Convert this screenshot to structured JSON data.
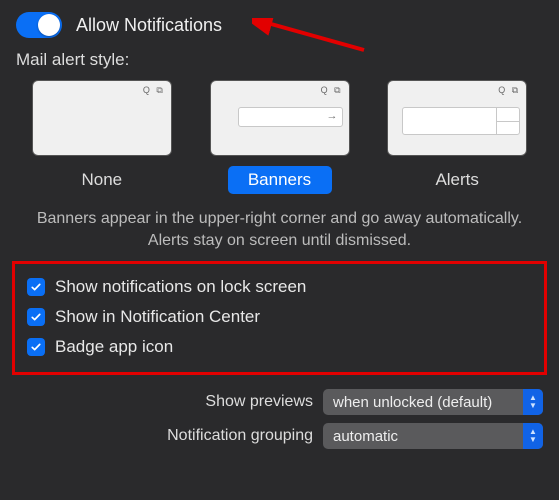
{
  "toggle": {
    "label": "Allow Notifications",
    "on": true
  },
  "sectionLabel": "Mail alert style:",
  "styles": {
    "none": "None",
    "banners": "Banners",
    "alerts": "Alerts",
    "selected": "Banners"
  },
  "description": "Banners appear in the upper-right corner and go away automatically. Alerts stay on screen until dismissed.",
  "checks": {
    "lockScreen": "Show notifications on lock screen",
    "notifCenter": "Show in Notification Center",
    "badge": "Badge app icon"
  },
  "previews": {
    "label": "Show previews",
    "value": "when unlocked (default)"
  },
  "grouping": {
    "label": "Notification grouping",
    "value": "automatic"
  },
  "colors": {
    "accent": "#0a6ff5",
    "annotation": "#e20000"
  }
}
